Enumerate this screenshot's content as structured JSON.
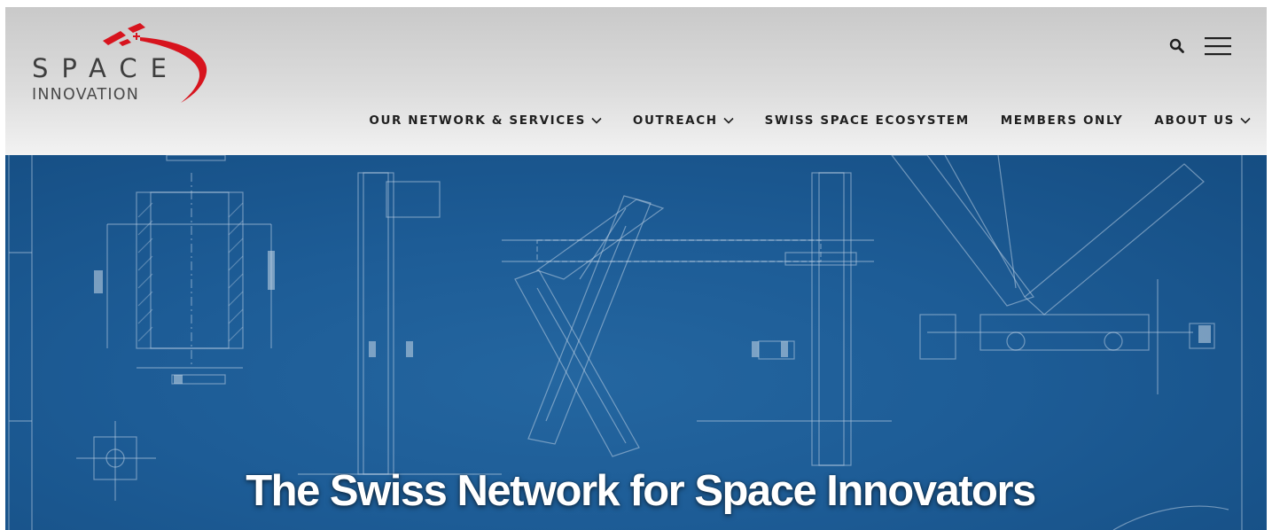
{
  "header": {
    "logo": {
      "line1": "SPACE",
      "line2": "INNOVATION"
    },
    "icons": {
      "search": "search-icon",
      "menu": "hamburger-menu-icon"
    },
    "nav": [
      {
        "label": "OUR NETWORK & SERVICES",
        "has_dropdown": true
      },
      {
        "label": "OUTREACH",
        "has_dropdown": true
      },
      {
        "label": "SWISS SPACE ECOSYSTEM",
        "has_dropdown": false
      },
      {
        "label": "MEMBERS ONLY",
        "has_dropdown": false
      },
      {
        "label": "ABOUT US",
        "has_dropdown": true
      }
    ]
  },
  "hero": {
    "title": "The Swiss Network for Space Innovators",
    "background": "blueprint-technical-drawing"
  },
  "colors": {
    "brand_red": "#d7141e",
    "hero_blue": "#1d5c96",
    "nav_text": "#1f1f1f"
  }
}
